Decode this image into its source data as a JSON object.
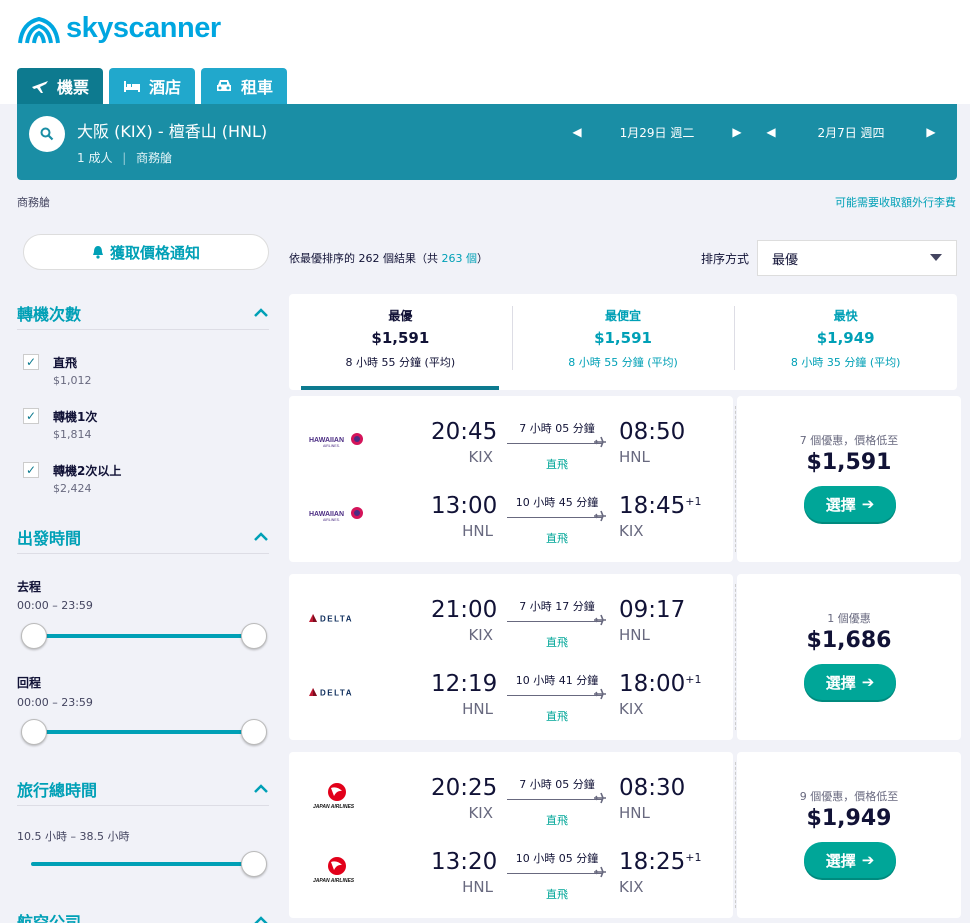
{
  "brand": {
    "logo_text": "skyscanner",
    "color": "#00a6e0"
  },
  "tabs": [
    {
      "label": "機票",
      "icon": "plane-icon"
    },
    {
      "label": "酒店",
      "icon": "bed-icon"
    },
    {
      "label": "租車",
      "icon": "car-icon"
    }
  ],
  "search": {
    "route": "大阪 (KIX) - 檀香山 (HNL)",
    "passengers": "1 成人",
    "cabin": "商務艙",
    "separator": "|",
    "depart_date": "1月29日 週二",
    "return_date": "2月7日 週四"
  },
  "cabin_label": "商務艙",
  "extra_fees": "可能需要收取額外行李費",
  "alert_button": "獲取價格通知",
  "filters": {
    "stops": {
      "title": "轉機次數",
      "options": [
        {
          "label": "直飛",
          "price": "$1,012"
        },
        {
          "label": "轉機1次",
          "price": "$1,814"
        },
        {
          "label": "轉機2次以上",
          "price": "$2,424"
        }
      ]
    },
    "times": {
      "title": "出發時間",
      "outbound": "去程",
      "outbound_range": "00:00 – 23:59",
      "return": "回程",
      "return_range": "00:00 – 23:59"
    },
    "duration": {
      "title": "旅行總時間",
      "range": "10.5 小時 – 38.5 小時"
    },
    "airlines": {
      "title": "航空公司"
    }
  },
  "results": {
    "text_prefix": "依最優排序的 262 個結果（共 ",
    "total": "263 個",
    "text_suffix": "）"
  },
  "sort": {
    "label": "排序方式",
    "value": "最優"
  },
  "summary": [
    {
      "label": "最優",
      "price": "$1,591",
      "duration": "8 小時 55 分鐘 (平均)"
    },
    {
      "label": "最便宜",
      "price": "$1,591",
      "duration": "8 小時 55 分鐘 (平均)"
    },
    {
      "label": "最快",
      "price": "$1,949",
      "duration": "8 小時 35 分鐘 (平均)"
    }
  ],
  "flights": [
    {
      "airline": "HAWAIIAN",
      "deals": "7 個優惠，價格低至",
      "price": "$1,591",
      "select": "選擇",
      "legs": [
        {
          "dep": "20:45",
          "from": "KIX",
          "dur": "7 小時 05 分鐘",
          "stops": "直飛",
          "arr": "08:50",
          "to": "HNL",
          "plus": ""
        },
        {
          "dep": "13:00",
          "from": "HNL",
          "dur": "10 小時 45 分鐘",
          "stops": "直飛",
          "arr": "18:45",
          "to": "KIX",
          "plus": "+1"
        }
      ]
    },
    {
      "airline": "DELTA",
      "deals": "1 個優惠",
      "price": "$1,686",
      "select": "選擇",
      "legs": [
        {
          "dep": "21:00",
          "from": "KIX",
          "dur": "7 小時 17 分鐘",
          "stops": "直飛",
          "arr": "09:17",
          "to": "HNL",
          "plus": ""
        },
        {
          "dep": "12:19",
          "from": "HNL",
          "dur": "10 小時 41 分鐘",
          "stops": "直飛",
          "arr": "18:00",
          "to": "KIX",
          "plus": "+1"
        }
      ]
    },
    {
      "airline": "JAPAN AIRLINES",
      "deals": "9 個優惠，價格低至",
      "price": "$1,949",
      "select": "選擇",
      "legs": [
        {
          "dep": "20:25",
          "from": "KIX",
          "dur": "7 小時 05 分鐘",
          "stops": "直飛",
          "arr": "08:30",
          "to": "HNL",
          "plus": ""
        },
        {
          "dep": "13:20",
          "from": "HNL",
          "dur": "10 小時 05 分鐘",
          "stops": "直飛",
          "arr": "18:25",
          "to": "KIX",
          "plus": "+1"
        }
      ]
    }
  ],
  "colors": {
    "teal": "#1a8ea5",
    "cyan": "#00a0b6",
    "green": "#00a698",
    "dark": "#111236"
  }
}
